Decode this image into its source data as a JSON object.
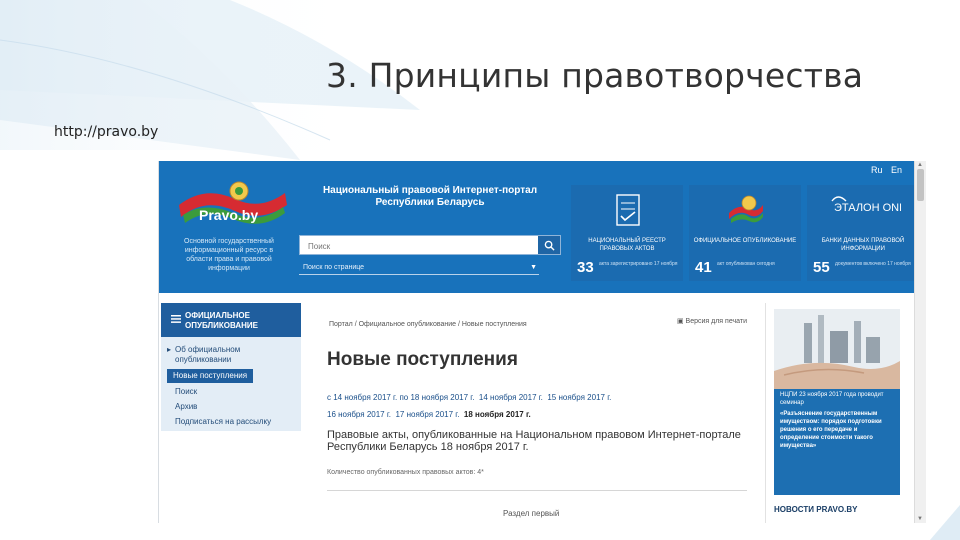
{
  "slide": {
    "title": "3. Принципы правотворчества",
    "url": "http://pravo.by"
  },
  "site": {
    "lang_ru": "Ru",
    "lang_en": "En",
    "logo_text": "Pravo.by",
    "tagline": "Основной государственный информационный ресурс в области права и правовой информации",
    "portal_name": "Национальный правовой Интернет-портал Республики Беларусь",
    "search_placeholder": "Поиск",
    "select_value": "Поиск по странице",
    "registers": [
      {
        "label": "НАЦИОНАЛЬНЫЙ РЕЕСТР ПРАВОВЫХ АКТОВ",
        "count": "33",
        "sub": "акта зарегистрировано 17 ноября"
      },
      {
        "label": "ОФИЦИАЛЬНОЕ ОПУБЛИКОВАНИЕ",
        "count": "41",
        "sub": "акт опубликован сегодня"
      },
      {
        "label": "БАНКИ ДАННЫХ ПРАВОВОЙ ИНФОРМАЦИИ",
        "count": "55",
        "sub": "документов включено 17 ноября"
      }
    ],
    "etalon_logo": "ЭТАЛОН ONLINE",
    "colors": {
      "header": "#1872bb",
      "sidebar_head": "#1f5e9e",
      "link": "#1a4f8a"
    }
  },
  "sidebar": {
    "heading": "ОФИЦИАЛЬНОЕ ОПУБЛИКОВАНИЕ",
    "items": [
      {
        "label": "Об официальном опубликовании"
      },
      {
        "label": "Новые поступления"
      },
      {
        "label": "Поиск"
      },
      {
        "label": "Архив"
      },
      {
        "label": "Подписаться на рассылку"
      }
    ]
  },
  "content": {
    "breadcrumb": "Портал / Официальное опубликование / Новые поступления",
    "print_label": "Версия для печати",
    "heading": "Новые поступления",
    "date_range": "с 14 ноября 2017 г. по 18 ноября 2017 г.",
    "dates": [
      "14 ноября 2017 г.",
      "15 ноября 2017 г.",
      "16 ноября 2017 г.",
      "17 ноября 2017 г."
    ],
    "current_date": "18 ноября 2017 г.",
    "acts_title": "Правовые акты, опубликованные на Национальном правовом Интернет-портале Республики Беларусь 18 ноября 2017 г.",
    "count": "Количество опубликованных правовых актов: 4*",
    "section": "Раздел первый"
  },
  "right": {
    "banner_text": "НЦПИ 23 ноября 2017 года проводит семинар",
    "banner_bold": "«Разъяснение государственным имуществом: порядок подготовки решения о его передаче и определение стоимости такого имущества»",
    "news_title": "НОВОСТИ PRAVO.BY"
  }
}
